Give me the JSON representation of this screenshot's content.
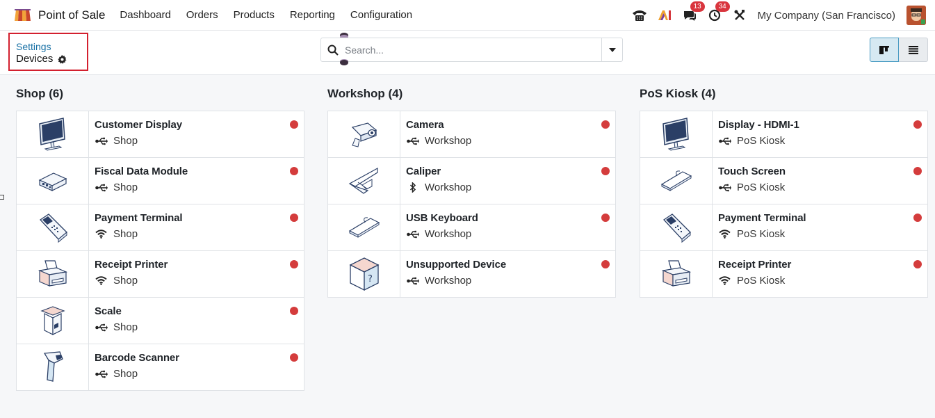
{
  "app": {
    "name": "Point of Sale"
  },
  "nav": [
    "Dashboard",
    "Orders",
    "Products",
    "Reporting",
    "Configuration"
  ],
  "systray": {
    "messages_badge": "13",
    "activities_badge": "34",
    "company": "My Company (San Francisco)"
  },
  "breadcrumb": {
    "parent": "Settings",
    "current": "Devices"
  },
  "search": {
    "placeholder": "Search..."
  },
  "columns": [
    {
      "title": "Shop (6)",
      "cards": [
        {
          "name": "Customer Display",
          "location": "Shop",
          "connection": "usb",
          "device": "monitor"
        },
        {
          "name": "Fiscal Data Module",
          "location": "Shop",
          "connection": "usb",
          "device": "fdm"
        },
        {
          "name": "Payment Terminal",
          "location": "Shop",
          "connection": "wifi",
          "device": "terminal"
        },
        {
          "name": "Receipt Printer",
          "location": "Shop",
          "connection": "wifi",
          "device": "printer"
        },
        {
          "name": "Scale",
          "location": "Shop",
          "connection": "usb",
          "device": "scale"
        },
        {
          "name": "Barcode Scanner",
          "location": "Shop",
          "connection": "usb",
          "device": "scanner"
        }
      ]
    },
    {
      "title": "Workshop (4)",
      "cards": [
        {
          "name": "Camera",
          "location": "Workshop",
          "connection": "usb",
          "device": "camera"
        },
        {
          "name": "Caliper",
          "location": "Workshop",
          "connection": "bluetooth",
          "device": "caliper"
        },
        {
          "name": "USB Keyboard",
          "location": "Workshop",
          "connection": "usb",
          "device": "keyboard"
        },
        {
          "name": "Unsupported Device",
          "location": "Workshop",
          "connection": "usb",
          "device": "unknown"
        }
      ]
    },
    {
      "title": "PoS Kiosk (4)",
      "cards": [
        {
          "name": "Display - HDMI-1",
          "location": "PoS Kiosk",
          "connection": "usb",
          "device": "monitor"
        },
        {
          "name": "Touch Screen",
          "location": "PoS Kiosk",
          "connection": "usb",
          "device": "keyboard"
        },
        {
          "name": "Payment Terminal",
          "location": "PoS Kiosk",
          "connection": "wifi",
          "device": "terminal"
        },
        {
          "name": "Receipt Printer",
          "location": "PoS Kiosk",
          "connection": "wifi",
          "device": "printer"
        }
      ]
    }
  ],
  "colors": {
    "status_disconnected": "#d43c3c",
    "link": "#1b72a6",
    "highlight_box": "#d3202f"
  }
}
